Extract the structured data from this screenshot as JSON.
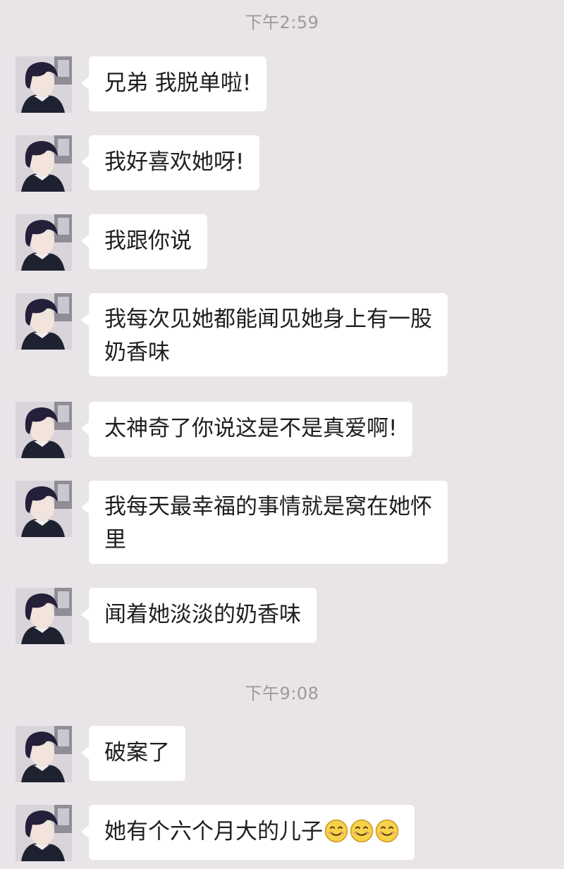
{
  "timestamps": [
    "下午2:59",
    "下午9:08"
  ],
  "messages": [
    {
      "lines": [
        "兄弟 我脱单啦!"
      ]
    },
    {
      "lines": [
        "我好喜欢她呀!"
      ]
    },
    {
      "lines": [
        "我跟你说"
      ]
    },
    {
      "lines": [
        "我每次见她都能闻见她身上有一股",
        "奶香味"
      ]
    },
    {
      "lines": [
        "太神奇了你说这是不是真爱啊!"
      ]
    },
    {
      "lines": [
        "我每天最幸福的事情就是窝在她怀",
        "里"
      ]
    },
    {
      "lines": [
        "闻着她淡淡的奶香味"
      ]
    },
    {
      "lines": [
        "破案了"
      ]
    },
    {
      "lines": [
        "她有个六个月大的儿子"
      ],
      "emoji": [
        "smile-emoji",
        "smile-emoji",
        "smile-emoji"
      ]
    }
  ],
  "colors": {
    "background": "#e8e4e8",
    "bubble": "#ffffff",
    "text": "#1f1f1f",
    "timestamp": "#9d9a9e"
  }
}
